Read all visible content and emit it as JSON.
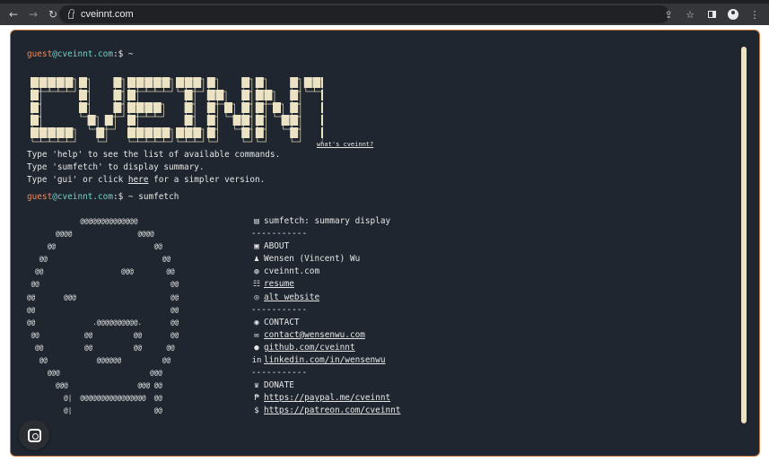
{
  "browser": {
    "url": "cveinnt.com",
    "nav_icons": [
      "back-icon",
      "forward-icon",
      "reload-icon"
    ],
    "right_icons": [
      "share-icon",
      "star-icon",
      "side-panel-icon",
      "profile-icon",
      "more-icon"
    ]
  },
  "terminal": {
    "prompt_user": "guest",
    "prompt_host": "@cveinnt.com",
    "prompt_suffix": ":$ ~",
    "banner_text": "CVEINNT",
    "what_link": "what's cveinnt?",
    "help_lines": [
      "Type 'help' to see the list of available commands.",
      "Type 'sumfetch' to display summary."
    ],
    "gui_prefix": "Type 'gui' or click ",
    "gui_link": "here",
    "gui_suffix": " for a simpler version.",
    "command": "sumfetch",
    "logo_art": [
      "             @@@@@@@@@@@@@@",
      "       @@@@                @@@@",
      "     @@                        @@",
      "   @@                            @@",
      "  @@                   @@@        @@",
      " @@                                @@",
      "@@       @@@                       @@",
      "@@                                 @@",
      "@@              .@@@@@@@@@@.       @@",
      " @@           @@          @@       @@",
      "  @@          @@          @@      @@",
      "   @@            @@@@@@          @@",
      "     @@@                      @@@",
      "       @@@                 @@@ @@",
      "         @|  @@@@@@@@@@@@@@@@  @@",
      "         @|                    @@"
    ],
    "info": [
      {
        "icon": "id-card-icon",
        "glyph": "▤",
        "text": "sumfetch: summary display",
        "link": false
      },
      {
        "icon": "",
        "glyph": "",
        "text": "-----------",
        "link": false
      },
      {
        "icon": "terminal-icon",
        "glyph": "▣",
        "text": "ABOUT",
        "link": false
      },
      {
        "icon": "user-icon",
        "glyph": "♟",
        "text": "Wensen (Vincent) Wu",
        "link": false
      },
      {
        "icon": "globe-icon",
        "glyph": "◍",
        "text": "cveinnt.com",
        "link": false
      },
      {
        "icon": "resume-icon",
        "glyph": "☷",
        "text": "resume",
        "link": true
      },
      {
        "icon": "web-icon",
        "glyph": "◎",
        "text": "alt website",
        "link": true
      },
      {
        "icon": "",
        "glyph": "",
        "text": "-----------",
        "link": false
      },
      {
        "icon": "contact-icon",
        "glyph": "◉",
        "text": "CONTACT",
        "link": false
      },
      {
        "icon": "mail-icon",
        "glyph": "✉",
        "text": "contact@wensenwu.com",
        "link": true
      },
      {
        "icon": "github-icon",
        "glyph": "●",
        "text": "github.com/cveinnt",
        "link": true
      },
      {
        "icon": "linkedin-icon",
        "glyph": "in",
        "text": "linkedin.com/in/wensenwu",
        "link": true
      },
      {
        "icon": "",
        "glyph": "",
        "text": "-----------",
        "link": false
      },
      {
        "icon": "donate-icon",
        "glyph": "♛",
        "text": "DONATE",
        "link": false
      },
      {
        "icon": "paypal-icon",
        "glyph": "₱",
        "text": "https://paypal.me/cveinnt",
        "link": true
      },
      {
        "icon": "dollar-icon",
        "glyph": "$",
        "text": "https://patreon.com/cveinnt",
        "link": true
      }
    ]
  },
  "colors": {
    "terminal_bg": "#1f262f",
    "border": "#c9773e",
    "user": "#eb8a5f",
    "host": "#6fd0c6",
    "banner": "#ece3c4"
  }
}
